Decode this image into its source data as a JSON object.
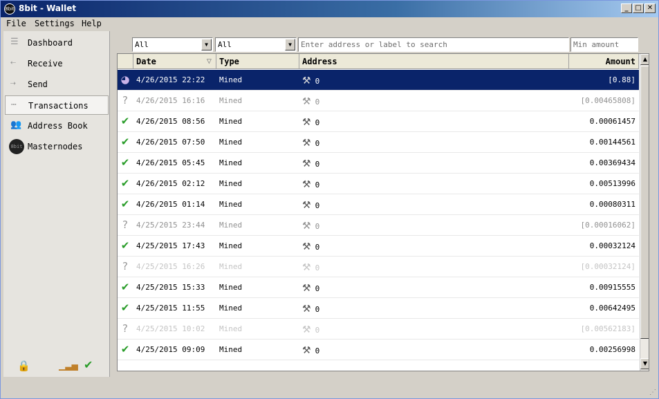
{
  "window": {
    "title": "8bit - Wallet",
    "icon_text": "8bit"
  },
  "menu": {
    "file": "File",
    "settings": "Settings",
    "help": "Help"
  },
  "sidebar": {
    "items": [
      {
        "label": "Dashboard",
        "icon": "dashboard-icon"
      },
      {
        "label": "Receive",
        "icon": "receive-icon"
      },
      {
        "label": "Send",
        "icon": "send-icon"
      },
      {
        "label": "Transactions",
        "icon": "transactions-icon"
      },
      {
        "label": "Address Book",
        "icon": "address-book-icon"
      },
      {
        "label": "Masternodes",
        "icon": "masternodes-icon",
        "icon_text": "8bit"
      }
    ],
    "active": "Transactions"
  },
  "filters": {
    "date": "All",
    "type": "All",
    "search_placeholder": "Enter address or label to search",
    "min_amount_placeholder": "Min amount"
  },
  "table": {
    "headers": {
      "date": "Date",
      "type": "Type",
      "address": "Address",
      "amount": "Amount"
    },
    "rows": [
      {
        "status": "pending",
        "date": "4/26/2015 22:22",
        "type": "Mined",
        "address": "0",
        "amount": "[0.88]",
        "style": "sel"
      },
      {
        "status": "unknown",
        "date": "4/26/2015 16:16",
        "type": "Mined",
        "address": "0",
        "amount": "[0.00465808]",
        "style": "dim"
      },
      {
        "status": "confirmed",
        "date": "4/26/2015 08:56",
        "type": "Mined",
        "address": "0",
        "amount": "0.00061457",
        "style": ""
      },
      {
        "status": "confirmed",
        "date": "4/26/2015 07:50",
        "type": "Mined",
        "address": "0",
        "amount": "0.00144561",
        "style": ""
      },
      {
        "status": "confirmed",
        "date": "4/26/2015 05:45",
        "type": "Mined",
        "address": "0",
        "amount": "0.00369434",
        "style": ""
      },
      {
        "status": "confirmed",
        "date": "4/26/2015 02:12",
        "type": "Mined",
        "address": "0",
        "amount": "0.00513996",
        "style": ""
      },
      {
        "status": "confirmed",
        "date": "4/26/2015 01:14",
        "type": "Mined",
        "address": "0",
        "amount": "0.00080311",
        "style": ""
      },
      {
        "status": "unknown",
        "date": "4/25/2015 23:44",
        "type": "Mined",
        "address": "0",
        "amount": "[0.00016062]",
        "style": "dim"
      },
      {
        "status": "confirmed",
        "date": "4/25/2015 17:43",
        "type": "Mined",
        "address": "0",
        "amount": "0.00032124",
        "style": ""
      },
      {
        "status": "unknown",
        "date": "4/25/2015 16:26",
        "type": "Mined",
        "address": "0",
        "amount": "[0.00032124]",
        "style": "faint"
      },
      {
        "status": "confirmed",
        "date": "4/25/2015 15:33",
        "type": "Mined",
        "address": "0",
        "amount": "0.00915555",
        "style": ""
      },
      {
        "status": "confirmed",
        "date": "4/25/2015 11:55",
        "type": "Mined",
        "address": "0",
        "amount": "0.00642495",
        "style": ""
      },
      {
        "status": "unknown",
        "date": "4/25/2015 10:02",
        "type": "Mined",
        "address": "0",
        "amount": "[0.00562183]",
        "style": "faint"
      },
      {
        "status": "confirmed",
        "date": "4/25/2015 09:09",
        "type": "Mined",
        "address": "0",
        "amount": "0.00256998",
        "style": ""
      }
    ]
  },
  "colors": {
    "selection": "#0a246a",
    "confirmed": "#2a9d2a",
    "titlebar": "#0a246a"
  }
}
